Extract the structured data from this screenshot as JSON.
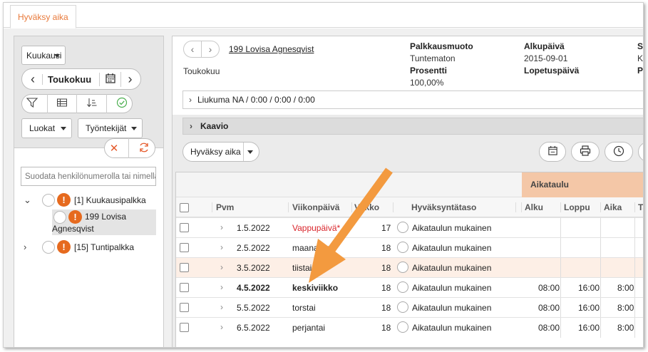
{
  "tab": {
    "label": "Hyväksy aika"
  },
  "left": {
    "period_select": "Kuukausi",
    "month": "Toukokuu",
    "luokat": "Luokat",
    "tyontekijat": "Työntekijät",
    "filter_placeholder": "Suodata henkilönumerolla tai nimellä",
    "groups": [
      {
        "label": "[1]  Kuukausipalkka"
      },
      {
        "label": "[15]  Tuntipalkka"
      }
    ],
    "employee": {
      "name_line1": "199 Lovisa",
      "name_line2": "Agnesqvist"
    }
  },
  "header": {
    "employee_link": "199 Lovisa Agnesqvist",
    "month": "Toukokuu",
    "palkkausmuoto_label": "Palkkausmuoto",
    "palkkausmuoto_value": "Tuntematon",
    "prosentti_label": "Prosentti",
    "prosentti_value": "100,00%",
    "alkupaiva_label": "Alkupäivä",
    "alkupaiva_value": "2015-09-01",
    "lopetuspaiva_label": "Lopetuspäivä",
    "col4_l1": "So",
    "col4_l2": "Ku",
    "col4_l3": "Pa",
    "liukuma": "Liukuma  NA / 0:00 / 0:00 / 0:00",
    "kaavio": "Kaavio"
  },
  "toolbar": {
    "approve": "Hyväksy aika"
  },
  "grid": {
    "group_header": "Aikataulu",
    "columns": {
      "pvm": "Pvm",
      "viikonpaiva": "Viikonpäivä",
      "viikko": "Viikko",
      "taso": "Hyväksyntätaso",
      "alku": "Alku",
      "loppu": "Loppu",
      "aika": "Aika",
      "ta": "Ta"
    },
    "rows": [
      {
        "pvm": "1.5.2022",
        "day": "Vappupäivä*",
        "week": "17",
        "taso": "Aikataulun mukainen",
        "alku": "",
        "loppu": "",
        "aika": ""
      },
      {
        "pvm": "2.5.2022",
        "day": "maanantai",
        "week": "18",
        "taso": "Aikataulun mukainen",
        "alku": "",
        "loppu": "",
        "aika": ""
      },
      {
        "pvm": "3.5.2022",
        "day": "tiistai",
        "week": "18",
        "taso": "Aikataulun mukainen",
        "alku": "",
        "loppu": "",
        "aika": ""
      },
      {
        "pvm": "4.5.2022",
        "day": "keskiviikko",
        "week": "18",
        "taso": "Aikataulun mukainen",
        "alku": "08:00",
        "loppu": "16:00",
        "aika": "8:00"
      },
      {
        "pvm": "5.5.2022",
        "day": "torstai",
        "week": "18",
        "taso": "Aikataulun mukainen",
        "alku": "08:00",
        "loppu": "16:00",
        "aika": "8:00"
      },
      {
        "pvm": "6.5.2022",
        "day": "perjantai",
        "week": "18",
        "taso": "Aikataulun mukainen",
        "alku": "08:00",
        "loppu": "16:00",
        "aika": "8:00"
      }
    ]
  },
  "colors": {
    "accent": "#e8793a",
    "holiday": "#d9252b",
    "highlight_row": "#fdefe6",
    "header_band": "#f4c7a7"
  }
}
